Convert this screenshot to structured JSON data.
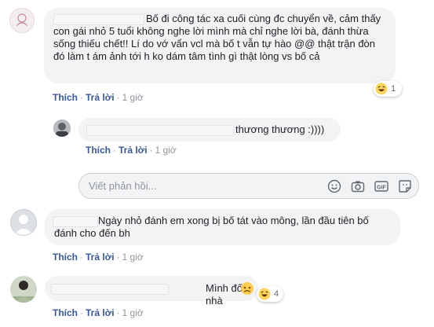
{
  "actions": {
    "like": "Thích",
    "reply": "Trả lời",
    "sep": "·",
    "time": "1 giờ"
  },
  "comments": [
    {
      "text": "Bố đi công tác xa cuối cùng đc chuyển về, cảm thấy con gái nhỏ 5 tuổi không nghe lời mình mà chỉ nghe lời bà, đánh thừa sống thiếu chết!! Lí do vớ vẩn vcl mà bố t vẫn tự hào @@ thật trận đòn đó làm t ám ảnh tới h ko dám tâm tình gì thật lòng vs bố cả",
      "reaction_count": "1"
    },
    {
      "text": "thương thương :))))"
    },
    {
      "text": "Ngày nhỏ đánh em xong bị bố tát vào mông, lần đầu tiên bố đánh cho đến bh"
    },
    {
      "text": "Mình đốt nhà",
      "reaction_count": "4"
    }
  ],
  "reply_input": {
    "placeholder": "Viết phản hồi..."
  },
  "icons": [
    "emoji-icon",
    "camera-icon",
    "gif-icon",
    "sticker-icon"
  ]
}
